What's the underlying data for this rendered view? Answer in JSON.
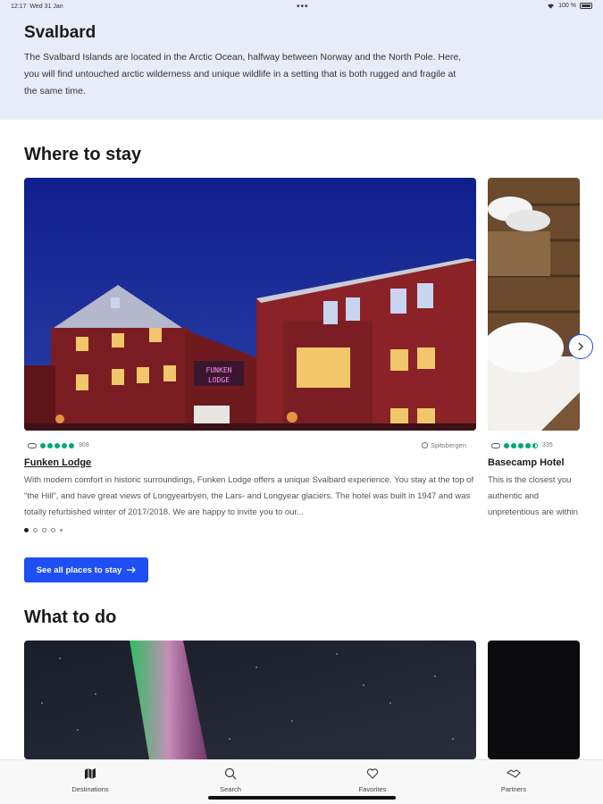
{
  "status_bar": {
    "time": "12:17",
    "date": "Wed 31 Jan",
    "battery": "100 %"
  },
  "hero": {
    "title": "Svalbard",
    "description": "The Svalbard Islands are located in the Arctic Ocean, halfway between Norway and the North Pole. Here, you will find untouched arctic wilderness and unique wildlife in a setting that is both rugged and fragile at the same time."
  },
  "stay": {
    "title": "Where to stay",
    "cards": [
      {
        "name": "Funken Lodge",
        "reviews": "909",
        "rating": 5,
        "location": "Spitsbergen",
        "description": "With modern comfort in historic surroundings, Funken Lodge offers a unique Svalbard experience. You stay at the top of \"the Hill\", and have great views of Longyearbyen, the Lars- and Longyear glaciers. The hotel was built in 1947 and was totally refurbished winter of 2017/2018. We are happy to invite you to our..."
      },
      {
        "name": "Basecamp Hotel",
        "reviews": "335",
        "rating": 4.5,
        "description": "This is the closest you authentic and unpretentious are within walking dis"
      }
    ],
    "cta_label": "See all places to stay"
  },
  "todo": {
    "title": "What to do"
  },
  "tabbar": {
    "tabs": [
      {
        "label": "Destinations",
        "icon": "map-icon"
      },
      {
        "label": "Search",
        "icon": "search-icon"
      },
      {
        "label": "Favorites",
        "icon": "heart-icon"
      },
      {
        "label": "Partners",
        "icon": "handshake-icon"
      }
    ]
  },
  "colors": {
    "hero_bg": "#e8ecfa",
    "accent": "#1d4ff2",
    "rating": "#00aa6c"
  }
}
